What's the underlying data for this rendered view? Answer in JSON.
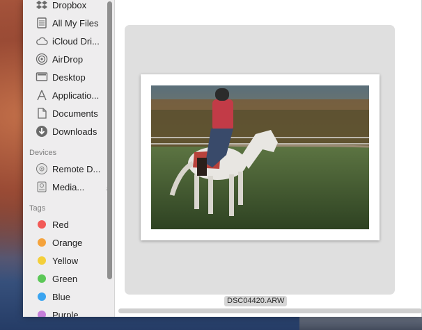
{
  "sidebar": {
    "favorites": [
      {
        "label": "Dropbox",
        "icon": "dropbox-icon"
      },
      {
        "label": "All My Files",
        "icon": "all-my-files-icon"
      },
      {
        "label": "iCloud Dri...",
        "icon": "cloud-icon"
      },
      {
        "label": "AirDrop",
        "icon": "airdrop-icon"
      },
      {
        "label": "Desktop",
        "icon": "desktop-icon"
      },
      {
        "label": "Applicatio...",
        "icon": "applications-icon"
      },
      {
        "label": "Documents",
        "icon": "documents-icon"
      },
      {
        "label": "Downloads",
        "icon": "downloads-icon"
      }
    ],
    "devices_header": "Devices",
    "devices": [
      {
        "label": "Remote D...",
        "icon": "disc-icon"
      },
      {
        "label": "Media...",
        "icon": "drive-icon"
      }
    ],
    "tags_header": "Tags",
    "tags": [
      {
        "label": "Red",
        "color": "#f25a57"
      },
      {
        "label": "Orange",
        "color": "#f5a33c"
      },
      {
        "label": "Yellow",
        "color": "#f4cf3a"
      },
      {
        "label": "Green",
        "color": "#5bc757"
      },
      {
        "label": "Blue",
        "color": "#3aa4f0"
      },
      {
        "label": "Purple",
        "color": "#c57ed9"
      }
    ]
  },
  "preview": {
    "filename": "DSC04420.ARW"
  }
}
